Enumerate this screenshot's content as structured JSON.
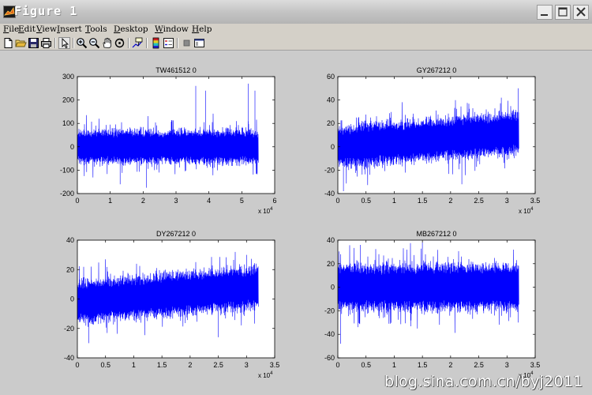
{
  "window": {
    "title": "Figure 1"
  },
  "menu": [
    "File",
    "Edit",
    "View",
    "Insert",
    "Tools",
    "Desktop",
    "Window",
    "Help"
  ],
  "toolbar": [
    "new-icon",
    "open-icon",
    "save-icon",
    "print-icon",
    "pointer-icon",
    "zoom-in-icon",
    "zoom-out-icon",
    "pan-icon",
    "rotate-icon",
    "data-cursor-icon",
    "colorbar-icon",
    "legend-icon",
    "hide-tools-icon",
    "show-tools-icon"
  ],
  "colors": {
    "series": "#0000ff",
    "axes_bg": "#ffffff",
    "figure_bg": "#cbcbcb"
  },
  "chart_data": [
    {
      "type": "line",
      "title": "TW461512  0",
      "xlim": [
        0,
        6
      ],
      "ylim": [
        -200,
        300
      ],
      "xticks": [
        "0",
        "1",
        "2",
        "3",
        "4",
        "5",
        "6"
      ],
      "yticks": [
        "-200",
        "-100",
        "0",
        "100",
        "200",
        "300"
      ],
      "x_exponent": "x 10",
      "x_exponent_power": "4",
      "samples": 55000,
      "data_end": 5.5,
      "trend": [
        0,
        0
      ],
      "noise_amplitude": 40,
      "extremes": [
        [
          3.6,
          260
        ],
        [
          3.9,
          240
        ],
        [
          5.2,
          270
        ],
        [
          5.4,
          240
        ],
        [
          2.1,
          -175
        ],
        [
          1.3,
          -160
        ]
      ]
    },
    {
      "type": "line",
      "title": "GY267212  0",
      "xlim": [
        0,
        3.5
      ],
      "ylim": [
        -40,
        60
      ],
      "xticks": [
        "0",
        "0.5",
        "1",
        "1.5",
        "2",
        "2.5",
        "3",
        "3.5"
      ],
      "yticks": [
        "-40",
        "-20",
        "0",
        "20",
        "40",
        "60"
      ],
      "x_exponent": "x 10",
      "x_exponent_power": "4",
      "samples": 32000,
      "data_end": 3.2,
      "trend": [
        0,
        12
      ],
      "noise_amplitude": 10,
      "extremes": [
        [
          3.2,
          50
        ],
        [
          2.9,
          42
        ],
        [
          0.1,
          -38
        ],
        [
          2.2,
          -32
        ]
      ]
    },
    {
      "type": "line",
      "title": "DY267212  0",
      "xlim": [
        0,
        3.5
      ],
      "ylim": [
        -40,
        40
      ],
      "xticks": [
        "0",
        "0.5",
        "1",
        "1.5",
        "2",
        "2.5",
        "3",
        "3.5"
      ],
      "yticks": [
        "-40",
        "-20",
        "0",
        "20",
        "40"
      ],
      "x_exponent": "x 10",
      "x_exponent_power": "4",
      "samples": 32000,
      "data_end": 3.2,
      "trend": [
        -2,
        8
      ],
      "noise_amplitude": 8,
      "extremes": [
        [
          2.8,
          32
        ],
        [
          3.0,
          30
        ],
        [
          0.2,
          -30
        ],
        [
          2.5,
          -26
        ]
      ]
    },
    {
      "type": "line",
      "title": "MB267212  0",
      "xlim": [
        0,
        3.5
      ],
      "ylim": [
        -60,
        40
      ],
      "xticks": [
        "0",
        "0.5",
        "1",
        "1.5",
        "2",
        "2.5",
        "3",
        "3.5"
      ],
      "yticks": [
        "-60",
        "-40",
        "-20",
        "0",
        "20",
        "40"
      ],
      "x_exponent": "x 10",
      "x_exponent_power": "4",
      "samples": 32000,
      "data_end": 3.2,
      "trend": [
        0,
        0
      ],
      "noise_amplitude": 11,
      "extremes": [
        [
          0.05,
          -48
        ],
        [
          1.5,
          38
        ],
        [
          0.4,
          36
        ],
        [
          3.2,
          -30
        ]
      ]
    }
  ],
  "watermark": "blog.sina.com.cn/byj2011"
}
